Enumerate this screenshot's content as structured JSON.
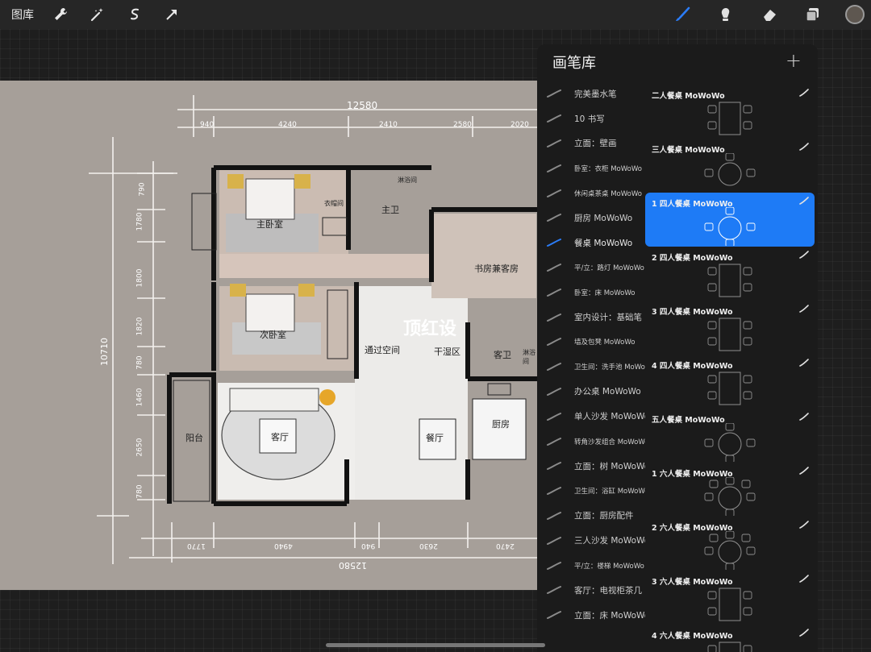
{
  "topbar": {
    "gallery_label": "图库",
    "tools_left": [
      "wrench-icon",
      "magic-wand-icon",
      "selection-icon",
      "transform-arrow-icon"
    ],
    "tools_right": [
      "brush-icon",
      "smudge-icon",
      "eraser-icon",
      "layers-icon"
    ],
    "active_tool": "brush-icon",
    "current_color": "#5e5750"
  },
  "floorplan": {
    "dimensions_top": [
      "12580",
      "940",
      "4240",
      "2410",
      "2580",
      "2020"
    ],
    "dimensions_left": [
      "10710",
      "790",
      "1780",
      "1800",
      "1820",
      "780",
      "1460",
      "2650",
      "780"
    ],
    "dimensions_bottom": [
      "1770",
      "4940",
      "940",
      "2630",
      "2470",
      "12580"
    ],
    "rooms": {
      "master_bedroom": "主卧室",
      "closet": "衣帽间",
      "master_bath": "主卫",
      "shower": "淋浴间",
      "study": "书房兼客房",
      "second_bedroom": "次卧室",
      "passage": "通过空间",
      "dry_wet": "干湿区",
      "guest_bath": "客卫",
      "shower2": "淋浴间",
      "balcony": "阳台",
      "living_room": "客厅",
      "dining": "餐厅",
      "kitchen": "厨房"
    },
    "watermark": "顶红设"
  },
  "panel": {
    "title": "画笔库",
    "add_label": "+",
    "brush_sets": [
      {
        "label": "完美墨水笔",
        "small": false
      },
      {
        "label": "10 书写",
        "small": false
      },
      {
        "label": "立面：壁画",
        "small": false
      },
      {
        "label": "卧室：衣柜 MoWoWo",
        "small": true
      },
      {
        "label": "休闲桌茶桌 MoWoWo",
        "small": true
      },
      {
        "label": "厨房 MoWoWo",
        "small": false
      },
      {
        "label": "餐桌 MoWoWo",
        "small": false,
        "active": true
      },
      {
        "label": "平/立：路灯 MoWoWo",
        "small": true
      },
      {
        "label": "卧室：床 MoWoWo",
        "small": true
      },
      {
        "label": "室内设计：基础笔",
        "small": false
      },
      {
        "label": "墙及包凳 MoWoWo",
        "small": true
      },
      {
        "label": "卫生间：洗手池 MoWoWo",
        "small": true
      },
      {
        "label": "办公桌 MoWoWo",
        "small": false
      },
      {
        "label": "单人沙发 MoWoWo",
        "small": false
      },
      {
        "label": "转角沙发组合 MoWoWo",
        "small": true
      },
      {
        "label": "立面：树 MoWoWo",
        "small": false
      },
      {
        "label": "卫生间：浴缸 MoWoWo",
        "small": true
      },
      {
        "label": "立面：厨房配件",
        "small": false
      },
      {
        "label": "三人沙发 MoWoWo",
        "small": false
      },
      {
        "label": "平/立：楼梯 MoWoWo",
        "small": true
      },
      {
        "label": "客厅：电视柜茶几",
        "small": false
      },
      {
        "label": "立面：床 MoWoWo",
        "small": false
      }
    ],
    "brushes": [
      {
        "name": "二人餐桌 MoWoWo",
        "preview": "table2"
      },
      {
        "name": "三人餐桌 MoWoWo",
        "preview": "round3"
      },
      {
        "name": "1 四人餐桌 MoWoWo",
        "preview": "round4",
        "selected": true
      },
      {
        "name": "2 四人餐桌 MoWoWo",
        "preview": "rect4"
      },
      {
        "name": "3 四人餐桌 MoWoWo",
        "preview": "rect4b"
      },
      {
        "name": "4 四人餐桌 MoWoWo",
        "preview": "rect4c"
      },
      {
        "name": "五人餐桌 MoWoWo",
        "preview": "round5"
      },
      {
        "name": "1 六人餐桌 MoWoWo",
        "preview": "round6"
      },
      {
        "name": "2 六人餐桌 MoWoWo",
        "preview": "round6b"
      },
      {
        "name": "3 六人餐桌 MoWoWo",
        "preview": "rect6"
      },
      {
        "name": "4 六人餐桌 MoWoWo",
        "preview": "rect6b"
      }
    ]
  }
}
